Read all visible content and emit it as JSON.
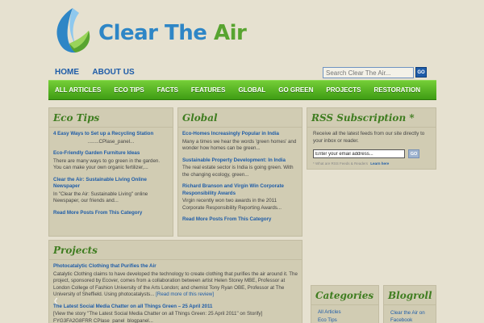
{
  "site": {
    "name_part1": "Clear The",
    "name_part2": "Air"
  },
  "topnav": [
    "HOME",
    "ABOUT US"
  ],
  "search": {
    "placeholder": "Search Clear The Air...",
    "button": "GO"
  },
  "categories_nav": [
    "ALL ARTICLES",
    "ECO TIPS",
    "FACTS",
    "FEATURES",
    "GLOBAL",
    "GO GREEN",
    "PROJECTS",
    "RESTORATION"
  ],
  "eco_tips": {
    "heading": "Eco Tips",
    "posts": [
      {
        "title": "4 Easy Ways to Set up a Recycling Station",
        "excerpt": "........CPlase_panel..."
      },
      {
        "title": "Eco-Friendly Garden Furniture Ideas",
        "excerpt": "There are many ways to go green in the garden. You can make your own organic fertilizer,..."
      },
      {
        "title": "Clear the Air: Sustainable Living Online Newspaper",
        "excerpt": "In \"Clear the Air: Sustainable Living\" online Newspaper, our friends and..."
      }
    ],
    "more": "Read More Posts From This Category"
  },
  "global": {
    "heading": "Global",
    "posts": [
      {
        "title": "Eco-Homes Increasingly Popular in India",
        "excerpt": "Many a times we hear the words 'green homes' and wonder how homes can be green..."
      },
      {
        "title": "Sustainable Property Development: In India",
        "excerpt": "The real estate sector is India is going green. With the changing ecology, green..."
      },
      {
        "title": "Richard Branson and Virgin Win Corporate Responsibility Awards",
        "excerpt": "Virgin recently won two awards in the 2011 Corporate Responsibility Reporting Awards..."
      }
    ],
    "more": "Read More Posts From This Category"
  },
  "rss": {
    "heading": "RSS Subscription *",
    "description": "Receive all the latest feeds from our site directly to your inbox or reader.",
    "email_value": "Enter your email address...",
    "button": "GO",
    "note": "* What are RSS Feeds & Readers",
    "learn_more": "Learn here"
  },
  "projects": {
    "heading": "Projects",
    "posts": [
      {
        "title": "Photocatalytic Clothing that Purifies the Air",
        "excerpt": "Catalytic Clothing claims to have developed the technology to create clothing that purifies the air around it. The project, sponsored by Ecover, comes from a collaboration between artist Helen Storey MBE, Professor at London College of Fashion University of the Arts London; and chemist Tony Ryan OBE, Professor at The University of Sheffield. Using photocatalysts...",
        "link": "[Read more of this review]"
      },
      {
        "title": "The Latest Social Media Chatter on all Things Green – 25 April 2011",
        "excerpt": "[View the story \"The Latest Social Media Chatter on all Things Green: 25 April 2011\" on Storify] FYG3FA2G8FRR CPlase_panel_blogpanel...",
        "link": ""
      }
    ]
  },
  "categories_panel": {
    "heading": "Categories",
    "items": [
      "All Articles",
      "Eco Tips"
    ]
  },
  "blogroll": {
    "heading": "Blogroll",
    "items": [
      "Clear the Air on Facebook"
    ]
  }
}
